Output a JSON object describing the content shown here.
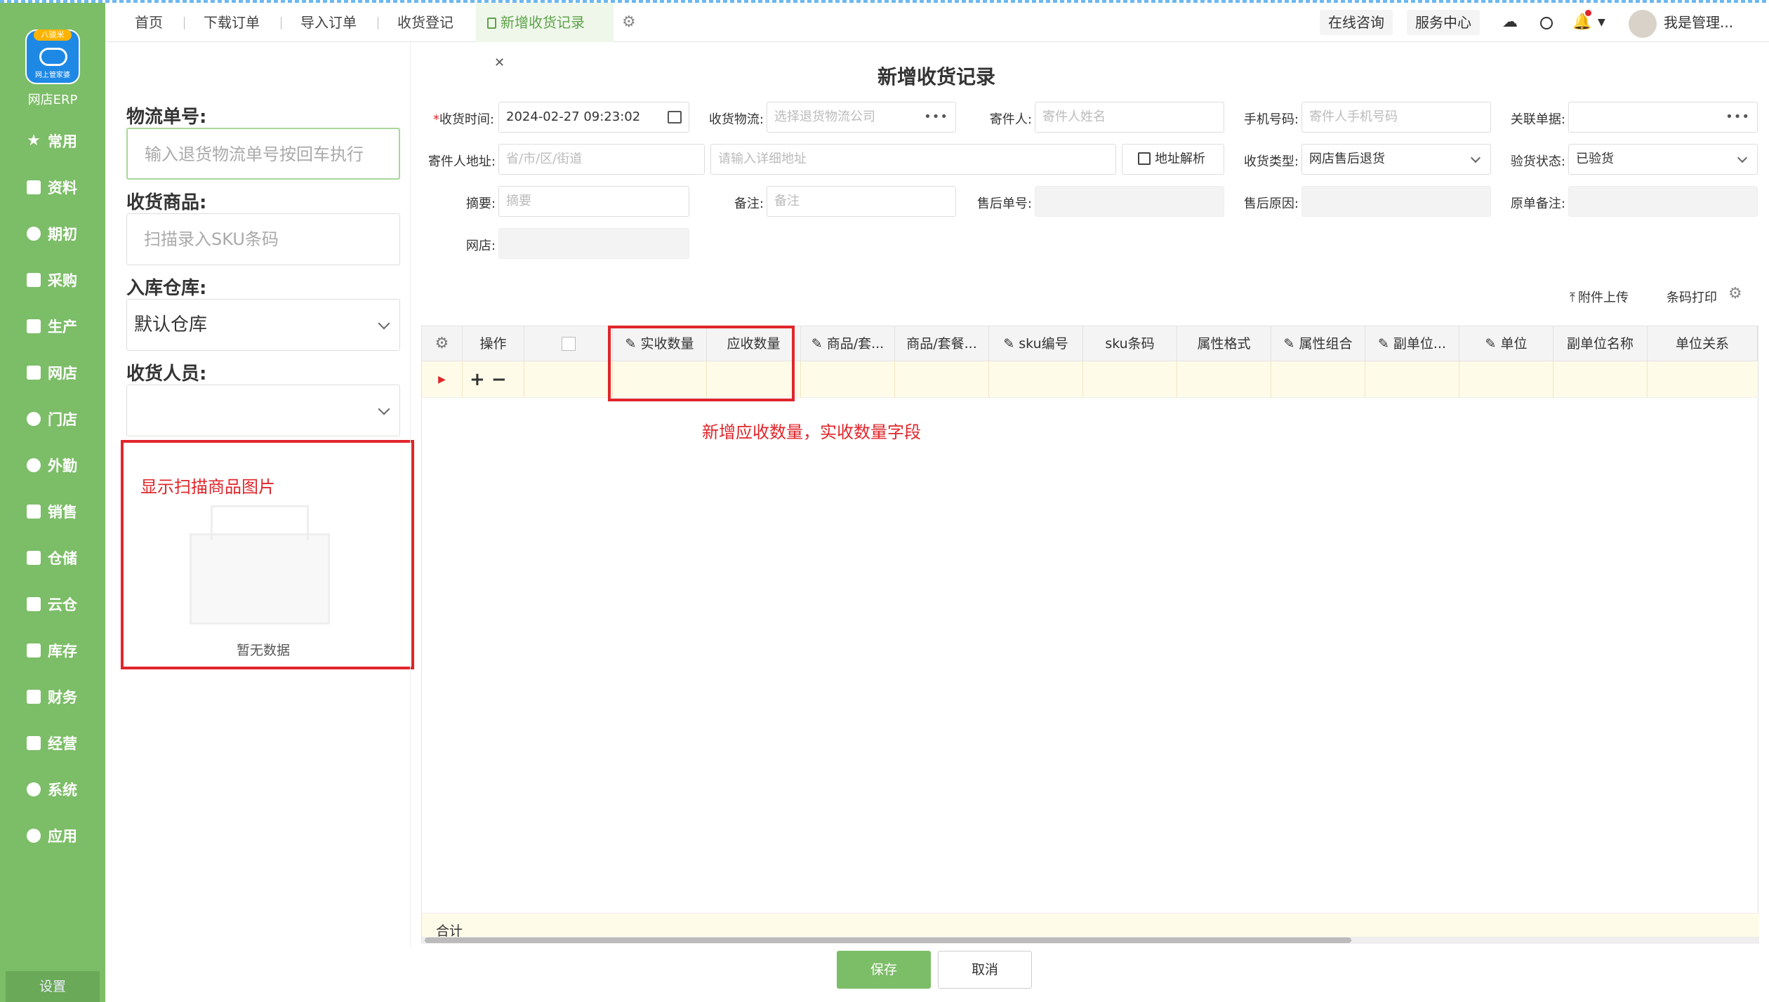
{
  "app": {
    "logo_badge": "八骏米",
    "logo_sub": "网上管家婆",
    "logo_text": "网店ERP"
  },
  "sidebar": {
    "items": [
      {
        "label": "常用",
        "icon": "star-icon"
      },
      {
        "label": "资料",
        "icon": "contact-card-icon"
      },
      {
        "label": "期初",
        "icon": "target-icon"
      },
      {
        "label": "采购",
        "icon": "purchase-icon"
      },
      {
        "label": "生产",
        "icon": "document-icon"
      },
      {
        "label": "网店",
        "icon": "store-icon"
      },
      {
        "label": "门店",
        "icon": "pie-chart-icon"
      },
      {
        "label": "外勤",
        "icon": "location-icon"
      },
      {
        "label": "销售",
        "icon": "bar-chart-icon"
      },
      {
        "label": "仓储",
        "icon": "warehouse-icon"
      },
      {
        "label": "云仓",
        "icon": "cloud-warehouse-icon"
      },
      {
        "label": "库存",
        "icon": "house-icon"
      },
      {
        "label": "财务",
        "icon": "finance-icon"
      },
      {
        "label": "经营",
        "icon": "business-icon"
      },
      {
        "label": "系统",
        "icon": "system-gear-icon"
      },
      {
        "label": "应用",
        "icon": "plus-app-icon"
      }
    ],
    "settings_label": "设置"
  },
  "tabs": [
    {
      "label": "首页"
    },
    {
      "label": "下载订单"
    },
    {
      "label": "导入订单"
    },
    {
      "label": "收货登记"
    },
    {
      "label": "新增收货记录",
      "active": true
    }
  ],
  "topbar": {
    "online": "在线咨询",
    "service": "服务中心",
    "user": "我是管理..."
  },
  "page_title": "新增收货记录",
  "left": {
    "logistics_label": "物流单号:",
    "logistics_placeholder": "输入退货物流单号按回车执行",
    "goods_label": "收货商品:",
    "goods_placeholder": "扫描录入SKU条码",
    "warehouse_label": "入库仓库:",
    "warehouse_value": "默认仓库",
    "staff_label": "收货人员:",
    "empty_text": "暂无数据",
    "annotation": "显示扫描商品图片"
  },
  "form": {
    "required_mark": "*",
    "receive_time_label": "收货时间:",
    "receive_time_value": "2024-02-27 09:23:02",
    "logistics_label": "收货物流:",
    "logistics_placeholder": "选择退货物流公司",
    "sender_label": "寄件人:",
    "sender_placeholder": "寄件人姓名",
    "phone_label": "手机号码:",
    "phone_placeholder": "寄件人手机号码",
    "related_label": "关联单据:",
    "address_label": "寄件人地址:",
    "region_placeholder": "省/市/区/街道",
    "detail_placeholder": "请输入详细地址",
    "parse_button": "地址解析",
    "type_label": "收货类型:",
    "type_value": "网店售后退货",
    "inspect_label": "验货状态:",
    "inspect_value": "已验货",
    "summary_label": "摘要:",
    "summary_placeholder": "摘要",
    "remark_label": "备注:",
    "remark_placeholder": "备注",
    "aftersale_no_label": "售后单号:",
    "aftersale_reason_label": "售后原因:",
    "orig_remark_label": "原单备注:",
    "shop_label": "网店:"
  },
  "toolbar": {
    "upload": "附件上传",
    "print": "条码打印"
  },
  "table": {
    "headers": [
      "操作",
      "实收数量",
      "应收数量",
      "商品/套...",
      "商品/套餐...",
      "sku编号",
      "sku条码",
      "属性格式",
      "属性组合",
      "副单位...",
      "单位",
      "副单位名称",
      "单位关系"
    ],
    "annotation": "新增应收数量，实收数量字段",
    "footer": "合计"
  },
  "buttons": {
    "save": "保存",
    "cancel": "取消"
  },
  "colors": {
    "accent": "#7cbd67",
    "annotation": "#e0262b"
  }
}
